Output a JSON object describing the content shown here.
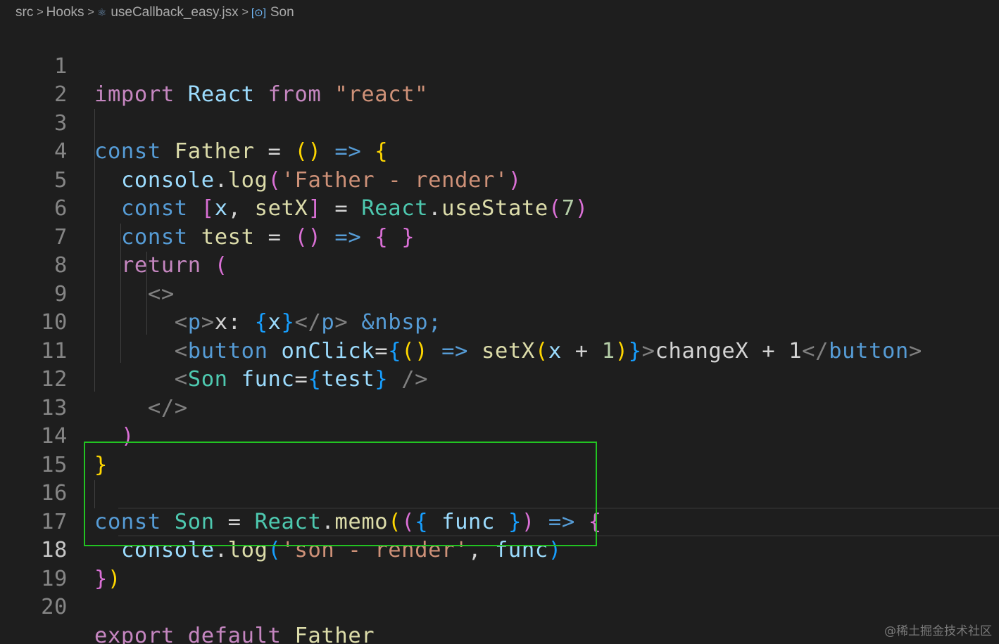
{
  "breadcrumb": {
    "items": [
      "src",
      "Hooks",
      "useCallback_easy.jsx",
      "Son"
    ],
    "separator": ">"
  },
  "editor": {
    "active_line": 18,
    "line_numbers": [
      "1",
      "2",
      "3",
      "4",
      "5",
      "6",
      "7",
      "8",
      "9",
      "10",
      "11",
      "12",
      "13",
      "14",
      "15",
      "16",
      "17",
      "18",
      "19",
      "20"
    ],
    "lines": [
      "import React from \"react\"",
      "",
      "const Father = () => {",
      "  console.log('Father - render')",
      "  const [x, setX] = React.useState(7)",
      "  const test = () => { }",
      "  return (",
      "    <>",
      "      <p>x: {x}</p> &nbsp;",
      "      <button onClick={() => setX(x + 1)}>changeX + 1</button>",
      "      <Son func={test} />",
      "    </>",
      "  )",
      "}",
      "",
      "const Son = React.memo(({ func }) => {",
      "  console.log('son - render', func)",
      "})",
      "",
      "export default Father"
    ]
  },
  "highlight": {
    "color": "#22c322",
    "lines": [
      16,
      18
    ]
  },
  "watermark": "@稀土掘金技术社区",
  "colors": {
    "background": "#1e1e1e",
    "keyword": "#c586c0",
    "storage": "#569cd6",
    "function": "#dcdcaa",
    "variable": "#9cdcfe",
    "class": "#4ec9b0",
    "string": "#ce9178"
  }
}
